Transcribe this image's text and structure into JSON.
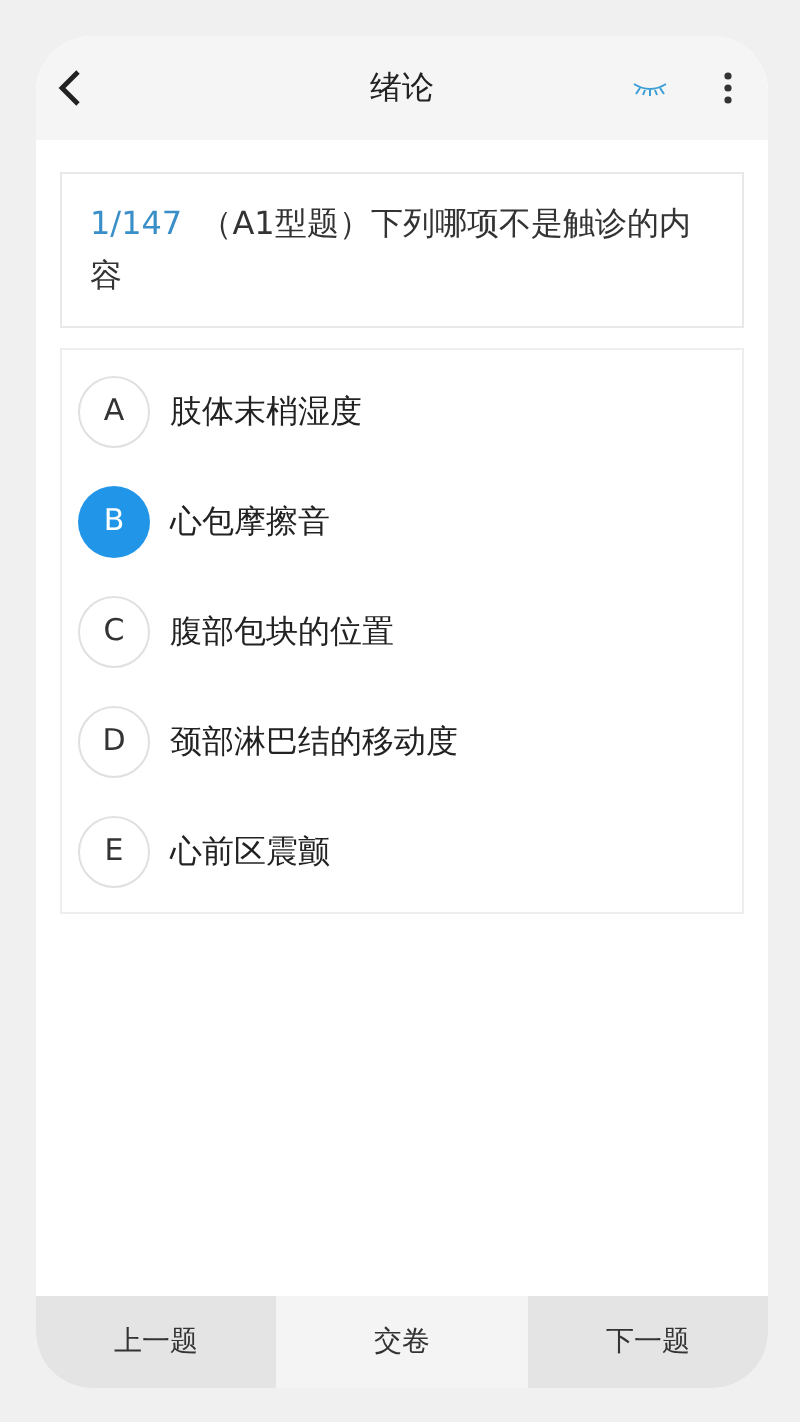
{
  "header": {
    "title": "绪论"
  },
  "question": {
    "number": "1/147",
    "text": "（A1型题）下列哪项不是触诊的内容"
  },
  "options": [
    {
      "letter": "A",
      "text": "肢体末梢湿度",
      "selected": false
    },
    {
      "letter": "B",
      "text": "心包摩擦音",
      "selected": true
    },
    {
      "letter": "C",
      "text": "腹部包块的位置",
      "selected": false
    },
    {
      "letter": "D",
      "text": "颈部淋巴结的移动度",
      "selected": false
    },
    {
      "letter": "E",
      "text": "心前区震颤",
      "selected": false
    }
  ],
  "bottom_bar": [
    {
      "label": "上一题",
      "kind": "nav"
    },
    {
      "label": "交卷",
      "kind": "submit"
    },
    {
      "label": "下一题",
      "kind": "nav"
    }
  ]
}
